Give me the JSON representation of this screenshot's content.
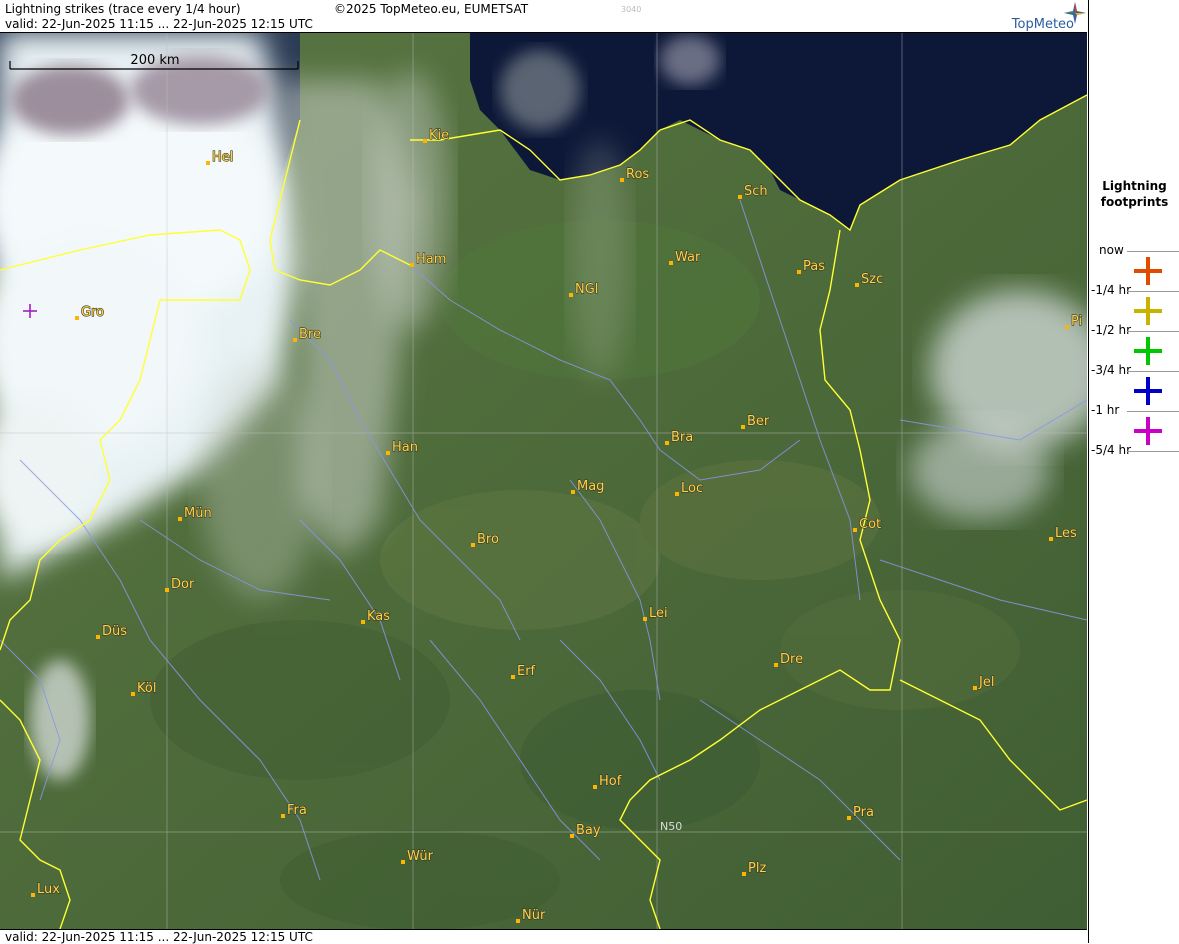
{
  "header": {
    "title": "Lightning strikes (trace every 1/4 hour)",
    "copyright": "©2025 TopMeteo.eu, EUMETSAT",
    "code": "3040",
    "valid": "valid:  22-Jun-2025 11:15 ... 22-Jun-2025 12:15 UTC",
    "logo": "TopMeteo"
  },
  "footer": {
    "valid": "valid:  22-Jun-2025 11:15 ... 22-Jun-2025 12:15 UTC"
  },
  "map": {
    "scale_label": "200 km",
    "grid_label": "N50",
    "cities": [
      "Kie",
      "Hel",
      "Ros",
      "Sch",
      "Ham",
      "War",
      "Pas",
      "Szc",
      "NGl",
      "Gro",
      "Bre",
      "Pi",
      "Ber",
      "Bra",
      "Han",
      "Mag",
      "Loc",
      "Mün",
      "Cot",
      "Les",
      "Bro",
      "Dor",
      "Kas",
      "Lei",
      "Düs",
      "Dre",
      "Erf",
      "Köl",
      "Jel",
      "Hof",
      "Fra",
      "Pra",
      "Bay",
      "Wür",
      "Plz",
      "Lux",
      "Nür"
    ],
    "strikes": [
      {
        "city_near": "Gro",
        "age": "-5/4 hr"
      }
    ],
    "colors": {
      "border": "#ffff33",
      "river": "#8a96e6",
      "sea": "#0d1838",
      "land": "#4e6a3b",
      "city": "#ffb400"
    }
  },
  "legend": {
    "title_line1": "Lightning",
    "title_line2": "footprints",
    "items": [
      {
        "label": "now",
        "color": "#e24a00"
      },
      {
        "label": "-1/4 hr",
        "color": "#c8b400"
      },
      {
        "label": "-1/2 hr",
        "color": "#00c800"
      },
      {
        "label": "-3/4 hr",
        "color": "#0000c8"
      },
      {
        "label": "-1 hr",
        "color": "#c800c8"
      },
      {
        "label": "-5/4 hr",
        "color": ""
      }
    ]
  }
}
